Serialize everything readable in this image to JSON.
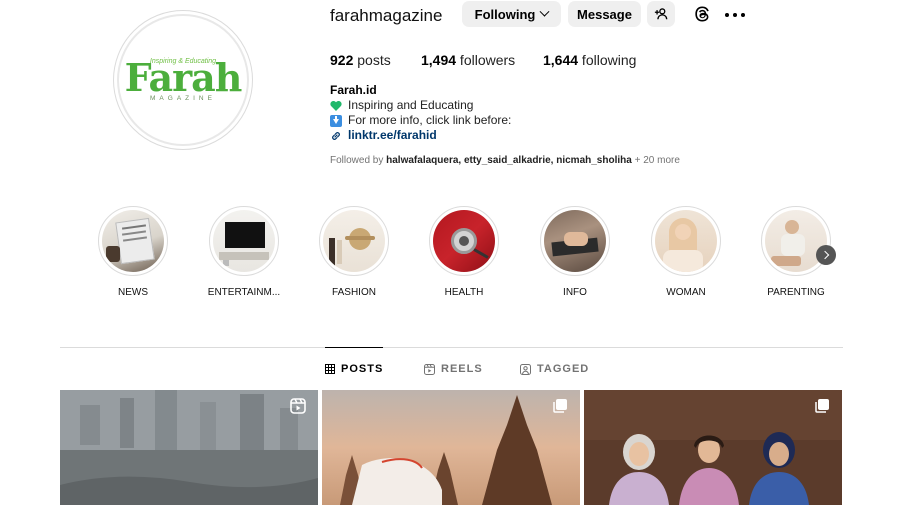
{
  "profile": {
    "username": "farahmagazine",
    "following_button": "Following",
    "message_button": "Message",
    "logo": {
      "tagline": "Inspiring & Educating",
      "word": "Farah",
      "sub": "MAGAZINE"
    },
    "stats": [
      {
        "value": "922",
        "label": " posts"
      },
      {
        "value": "1,494",
        "label": " followers"
      },
      {
        "value": "1,644",
        "label": " following"
      }
    ],
    "bio": {
      "name": "Farah.id",
      "line1": "Inspiring and Educating",
      "line2": "For more info, click link before:",
      "link": "linktr.ee/farahid"
    },
    "followed_by": {
      "prefix": "Followed by ",
      "users": "halwafalaquera, etty_said_alkadrie, nicmah_sholiha",
      "suffix": " + 20 more"
    }
  },
  "highlights": [
    {
      "label": "NEWS"
    },
    {
      "label": "ENTERTAINM..."
    },
    {
      "label": "FASHION"
    },
    {
      "label": "HEALTH"
    },
    {
      "label": "INFO"
    },
    {
      "label": "WOMAN"
    },
    {
      "label": "PARENTING"
    }
  ],
  "tabs": [
    {
      "label": "POSTS",
      "active": true
    },
    {
      "label": "REELS",
      "active": false
    },
    {
      "label": "TAGGED",
      "active": false
    }
  ],
  "colors": {
    "brand_green": "#4cae3c",
    "link": "#00376b",
    "button_bg": "#efefef"
  },
  "icons": [
    "add-user-icon",
    "threads-icon",
    "more-options-icon",
    "heart-icon",
    "down-arrow-icon",
    "link-icon",
    "chevron-right-icon",
    "grid-icon",
    "reels-icon",
    "tagged-icon",
    "multiple-posts-icon"
  ]
}
